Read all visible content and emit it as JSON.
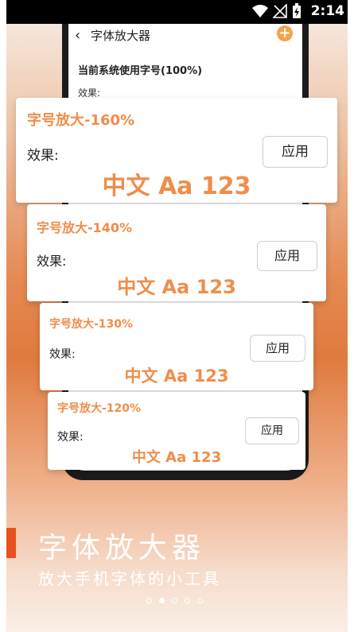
{
  "status": {
    "time": "2:14"
  },
  "app_screen": {
    "back_icon": "chevron-left-icon",
    "title": "字体放大器",
    "add_icon": "plus-circle-icon",
    "system_font_label": "当前系统使用字号(100%)",
    "effect_label": "效果:"
  },
  "cards": [
    {
      "title": "字号放大-160%",
      "effect_label": "效果:",
      "apply_label": "应用",
      "sample": "中文 Aa 123"
    },
    {
      "title": "字号放大-140%",
      "effect_label": "效果:",
      "apply_label": "应用",
      "sample": "中文 Aa 123"
    },
    {
      "title": "字号放大-130%",
      "effect_label": "效果:",
      "apply_label": "应用",
      "sample": "中文 Aa 123"
    },
    {
      "title": "字号放大-120%",
      "effect_label": "效果:",
      "apply_label": "应用",
      "sample": "中文 Aa 123"
    }
  ],
  "promo": {
    "title": "字体放大器",
    "subtitle": "放大手机字体的小工具"
  },
  "pager": {
    "count": 5,
    "active_index": 1
  },
  "colors": {
    "accent": "#ef8d4a",
    "brand_bar": "#e8501e"
  }
}
